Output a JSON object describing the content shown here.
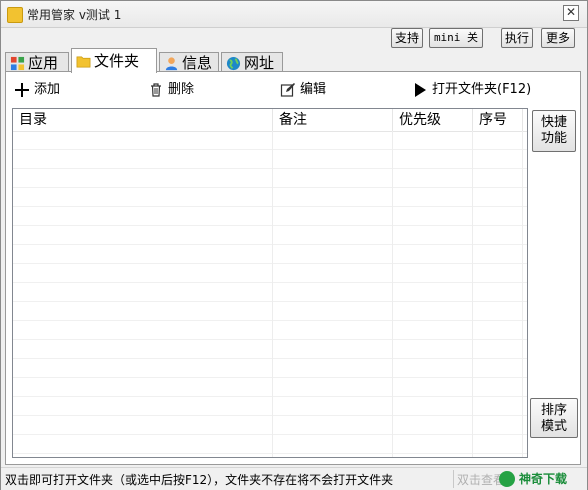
{
  "window": {
    "title": "常用管家 v测试 1",
    "close_label": "✕"
  },
  "top_buttons": {
    "support": "支持",
    "mini": "mini 关",
    "execute": "执行",
    "more": "更多"
  },
  "tabs": [
    {
      "label": "应用",
      "icon": "apps-icon"
    },
    {
      "label": "文件夹",
      "icon": "folder-icon"
    },
    {
      "label": "信息",
      "icon": "user-icon"
    },
    {
      "label": "网址",
      "icon": "globe-icon"
    }
  ],
  "active_tab": 1,
  "toolbar": {
    "add": "添加",
    "delete": "删除",
    "edit": "编辑",
    "open_folder": "打开文件夹(F12)"
  },
  "table": {
    "columns": [
      "目录",
      "备注",
      "优先级",
      "序号"
    ],
    "rows": []
  },
  "side_buttons": {
    "quick": "快捷功能",
    "sort": "排序模式"
  },
  "status": {
    "text": "双击即可打开文件夹（或选中后按F12），文件夹不存在将不会打开文件夹",
    "hint": "双击查看",
    "watermark": "神奇下载"
  },
  "colors": {
    "accent_green": "#25a244",
    "folder_yellow": "#f2c230",
    "border": "#828790"
  }
}
